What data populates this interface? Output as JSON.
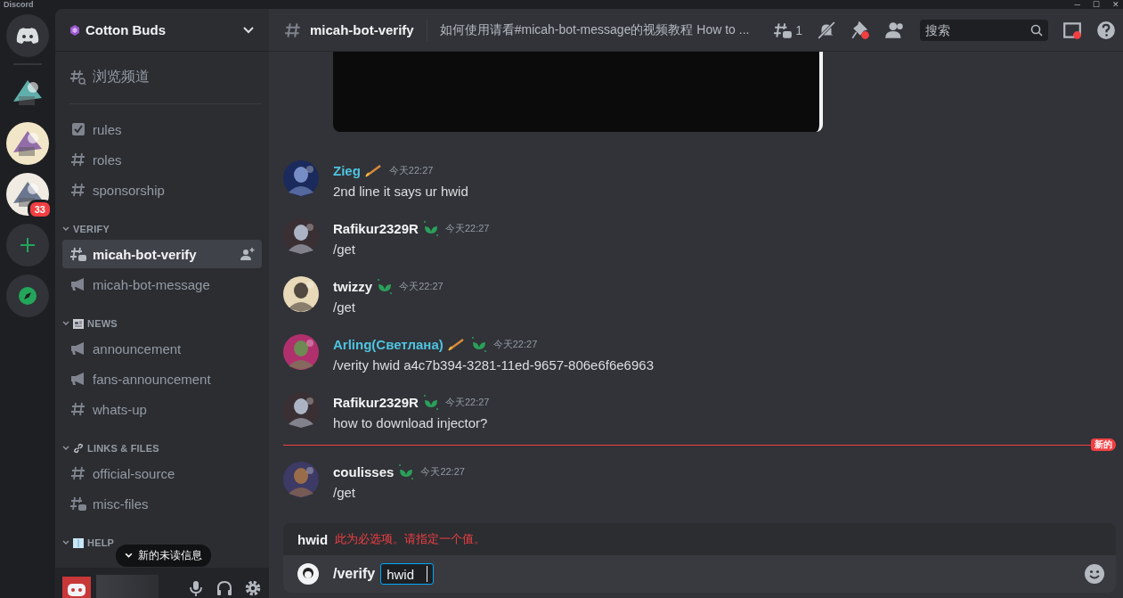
{
  "window": {
    "title": "Discord",
    "controls": [
      "─",
      "☐",
      "✕"
    ]
  },
  "servers": [
    {
      "kind": "home"
    },
    {
      "kind": "picture"
    },
    {
      "kind": "picture"
    },
    {
      "kind": "picture",
      "badge": "33"
    },
    {
      "kind": "add"
    },
    {
      "kind": "explore"
    }
  ],
  "guild": {
    "name": "Cotton Buds"
  },
  "browse": {
    "label": "浏览频道"
  },
  "channels": [
    {
      "kind": "rules",
      "name": "rules",
      "selected": false
    },
    {
      "kind": "text",
      "name": "roles",
      "selected": false
    },
    {
      "kind": "text",
      "name": "sponsorship",
      "selected": false
    }
  ],
  "categories": [
    {
      "name": "VERIFY",
      "kind": "plain",
      "expanded": true,
      "channels": [
        {
          "kind": "thread",
          "name": "micah-bot-verify",
          "selected": true
        },
        {
          "kind": "announcement",
          "name": "micah-bot-message",
          "selected": false
        }
      ]
    },
    {
      "name": "NEWS",
      "kind": "news",
      "expanded": true,
      "channels": [
        {
          "kind": "announcement",
          "name": "announcement",
          "selected": false
        },
        {
          "kind": "announcement",
          "name": "fans-announcement",
          "selected": false
        },
        {
          "kind": "text",
          "name": "whats-up",
          "selected": false
        }
      ]
    },
    {
      "name": "LINKS & FILES",
      "kind": "links",
      "expanded": true,
      "channels": [
        {
          "kind": "text",
          "name": "official-source",
          "selected": false
        },
        {
          "kind": "thread",
          "name": "misc-files",
          "selected": false
        }
      ]
    },
    {
      "name": "HELP",
      "kind": "help",
      "expanded": true
    }
  ],
  "unread_tooltip": "新的未读信息",
  "header": {
    "channel": "micah-bot-verify",
    "topic": "如何使用请看#micah-bot-message的视频教程 How to ...",
    "thread_count": "1",
    "search": {
      "placeholder": "搜索"
    }
  },
  "attachment": {
    "kind": "video"
  },
  "messages": [
    {
      "author": "Zieg",
      "color": "#4fc3e0",
      "badges": [
        {
          "kind": "pencil"
        }
      ],
      "time": "今天22:27",
      "text": "2nd line it says ur hwid",
      "new_before": false
    },
    {
      "author": "Rafikur2329R",
      "color": "#f2f3f5",
      "badges": [
        {
          "kind": "sprout"
        }
      ],
      "time": "今天22:27",
      "text": "/get",
      "new_before": false
    },
    {
      "author": "twizzy",
      "color": "#f2f3f5",
      "badges": [
        {
          "kind": "sprout"
        }
      ],
      "time": "今天22:27",
      "text": "/get",
      "new_before": false
    },
    {
      "author": "Arling(Светлана)",
      "color": "#4fc3e0",
      "badges": [
        {
          "kind": "pencil"
        },
        {
          "kind": "sprout"
        }
      ],
      "time": "今天22:27",
      "text": "/verity hwid a4c7b394-3281-11ed-9657-806e6f6e6963",
      "new_before": false
    },
    {
      "author": "Rafikur2329R",
      "color": "#f2f3f5",
      "badges": [
        {
          "kind": "sprout"
        }
      ],
      "time": "今天22:27",
      "text": "how to download injector?",
      "new_before": false
    },
    {
      "author": "coulisses",
      "color": "#f2f3f5",
      "badges": [
        {
          "kind": "sprout"
        }
      ],
      "time": "今天22:27",
      "text": "/get",
      "new_before": true
    }
  ],
  "new_label": "新的",
  "command": {
    "option": "hwid",
    "error": "此为必选项。请指定一个值。",
    "name": "/verify",
    "param": "hwid"
  }
}
